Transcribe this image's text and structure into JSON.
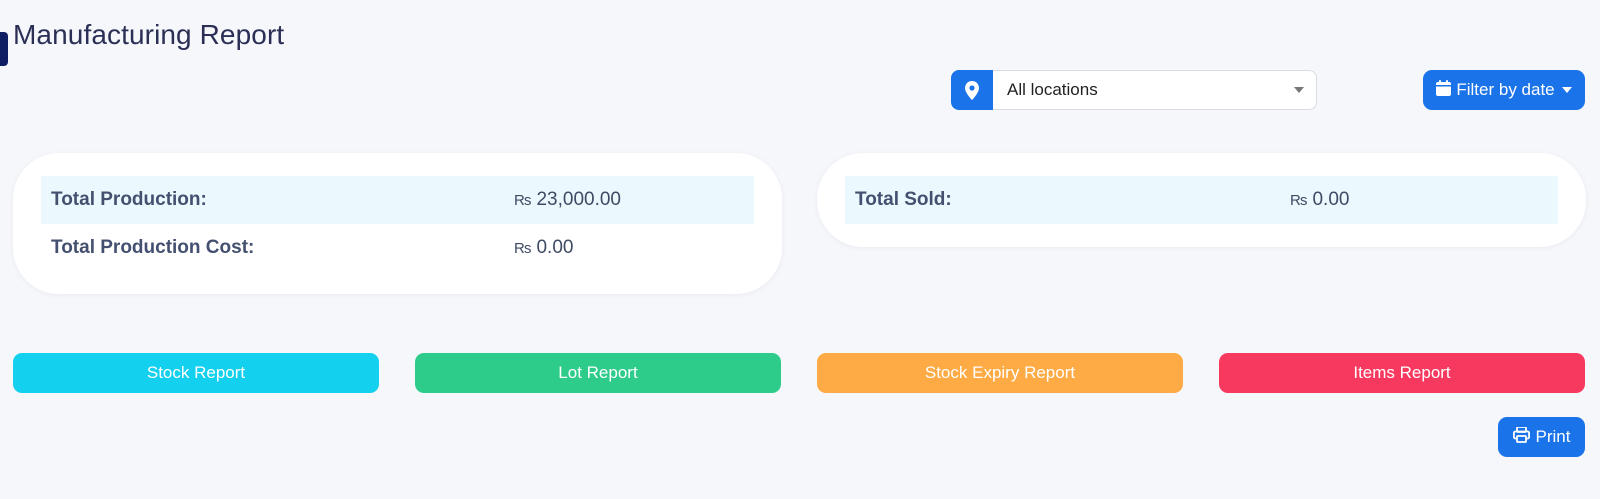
{
  "header": {
    "title": "Manufacturing Report"
  },
  "filters": {
    "location_selected": "All locations",
    "location_icon": "map-marker-icon",
    "filter_date_label": "Filter by date",
    "filter_date_icon": "calendar-icon"
  },
  "production_card": {
    "rows": [
      {
        "label": "Total Production:",
        "currency": "₨",
        "value": "23,000.00"
      },
      {
        "label": "Total Production Cost:",
        "currency": "₨",
        "value": "0.00"
      }
    ]
  },
  "sales_card": {
    "rows": [
      {
        "label": "Total Sold:",
        "currency": "₨",
        "value": "0.00"
      }
    ]
  },
  "report_buttons": [
    {
      "label": "Stock Report",
      "color": "#13d0ef"
    },
    {
      "label": "Lot Report",
      "color": "#2ecc8a"
    },
    {
      "label": "Stock Expiry Report",
      "color": "#ffab45"
    },
    {
      "label": "Items Report",
      "color": "#f8395f"
    }
  ],
  "actions": {
    "print_label": "Print",
    "print_icon": "printer-icon"
  },
  "colors": {
    "primary": "#1a73e8",
    "background": "#f6f7fb",
    "card": "#ffffff",
    "row_highlight": "#ebf8fd"
  }
}
